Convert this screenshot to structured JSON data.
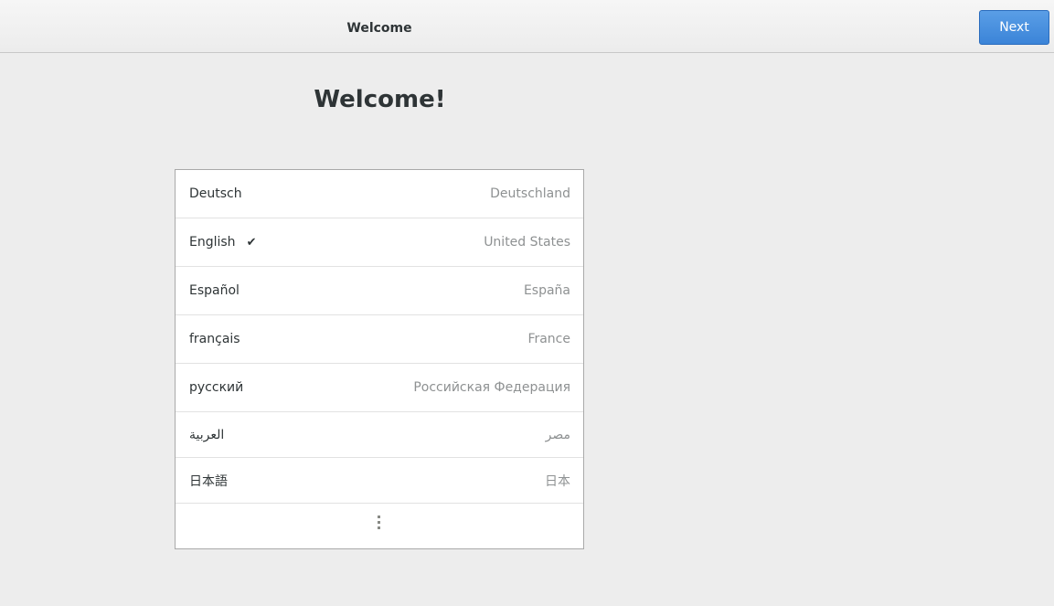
{
  "header": {
    "title": "Welcome",
    "next_label": "Next"
  },
  "main": {
    "title": "Welcome!",
    "languages": [
      {
        "name": "Deutsch",
        "region": "Deutschland",
        "selected": false
      },
      {
        "name": "English",
        "region": "United States",
        "selected": true
      },
      {
        "name": "Español",
        "region": "España",
        "selected": false
      },
      {
        "name": "français",
        "region": "France",
        "selected": false
      },
      {
        "name": "русский",
        "region": "Российская Федерация",
        "selected": false
      },
      {
        "name": "العربية",
        "region": "مصر",
        "selected": false
      },
      {
        "name": "日本語",
        "region": "日本",
        "selected": false
      }
    ],
    "check_glyph": "✔",
    "more_icon": "vertical-ellipsis-icon"
  },
  "colors": {
    "accent": "#3b84d8",
    "background": "#ededed",
    "list_background": "#ffffff",
    "region_text": "#8e9192"
  }
}
